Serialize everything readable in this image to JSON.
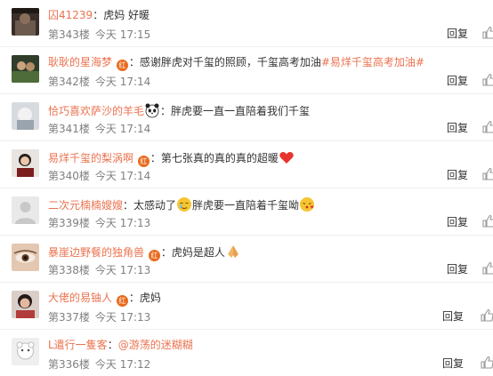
{
  "comments": [
    {
      "name": "囚41239",
      "has_badge": false,
      "text": "虎妈  好暖",
      "floor": "第343楼",
      "time": "今天 17:15",
      "reply": "回复"
    },
    {
      "name": "耿耿的星海梦",
      "has_badge": true,
      "text": "感谢胖虎对千玺的照顾，千玺高考加油",
      "tag": "#易烊千玺高考加油#",
      "floor": "第342楼",
      "time": "今天 17:14",
      "reply": "回复"
    },
    {
      "name": "恰巧喜欢萨沙的羊毛",
      "has_badge": false,
      "emoji_after_name": "panda",
      "text": "胖虎要一直一直陪着我们千玺",
      "floor": "第341楼",
      "time": "今天 17:14",
      "reply": "回复"
    },
    {
      "name": "易烊千玺的梨涡啊",
      "has_badge": true,
      "text": "第七张真的真的真的超暖",
      "emoji_end": "heart",
      "floor": "第340楼",
      "time": "今天 17:14",
      "reply": "回复"
    },
    {
      "name": "二次元楠楠嫂嫂",
      "has_badge": false,
      "text_a": "太感动了",
      "emoji_mid": "moved",
      "text_b": "胖虎要一直陪着千玺呦",
      "emoji_end": "kiss",
      "floor": "第339楼",
      "time": "今天 17:13",
      "reply": "回复"
    },
    {
      "name": "暴崖边野餐的独角兽",
      "has_badge": true,
      "text": "虎妈是超人",
      "emoji_end": "hands",
      "floor": "第338楼",
      "time": "今天 17:13",
      "reply": "回复"
    },
    {
      "name": "大佬的易铀人",
      "has_badge": true,
      "text": "虎妈",
      "floor": "第337楼",
      "time": "今天 17:13",
      "reply": "回复"
    },
    {
      "name": "L遣行一隻客",
      "has_badge": false,
      "text": "@游荡的迷糊糊",
      "floor": "第336楼",
      "time": "今天 17:12",
      "reply": "回复"
    }
  ],
  "badge_text": "红",
  "colors": {
    "username": "#eb7350",
    "badge": "#e86a1c",
    "meta": "#808080",
    "divider": "#eeeeee"
  },
  "icons": {
    "like": "thumbs-up-icon"
  }
}
